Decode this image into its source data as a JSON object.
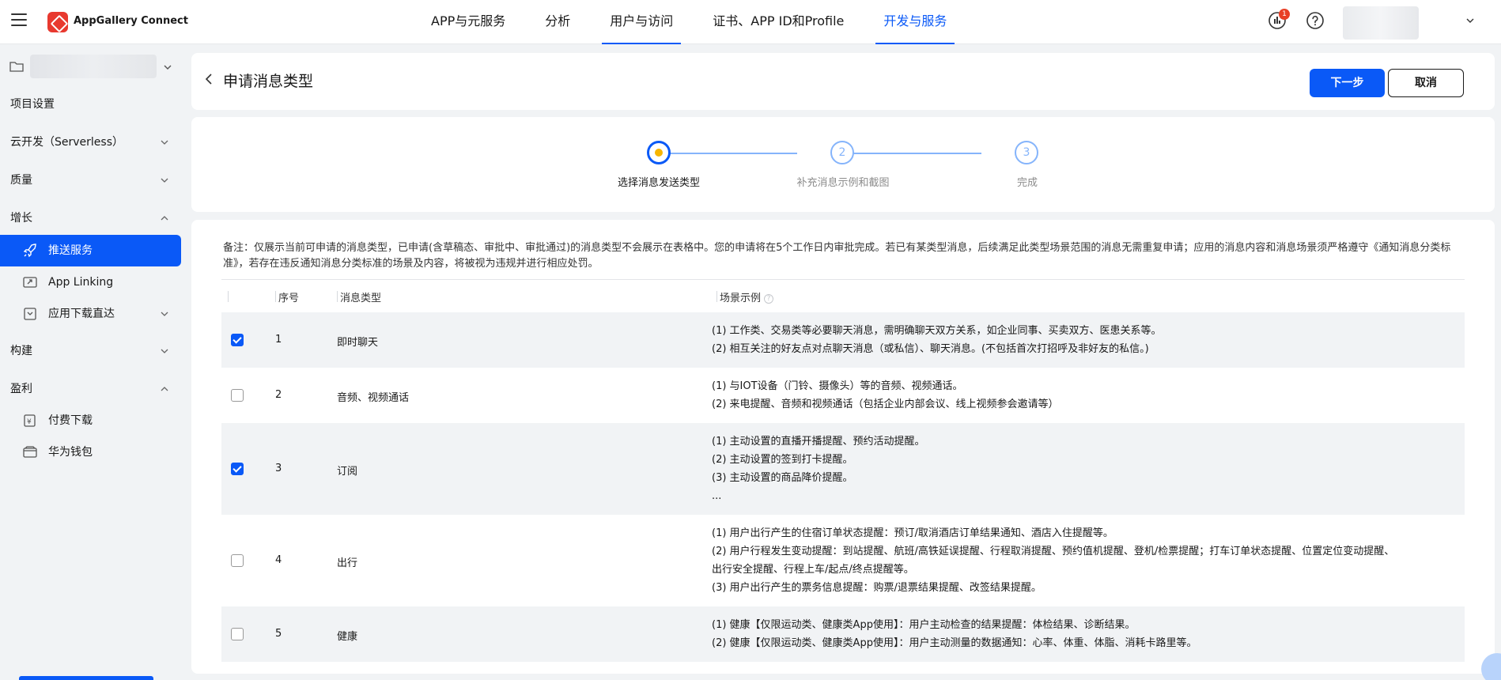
{
  "topbar": {
    "brand": "AppGallery Connect",
    "nav": [
      {
        "label": "APP与元服务",
        "state": "normal"
      },
      {
        "label": "分析",
        "state": "normal"
      },
      {
        "label": "用户与访问",
        "state": "underline"
      },
      {
        "label": "证书、APP ID和Profile",
        "state": "normal"
      },
      {
        "label": "开发与服务",
        "state": "active"
      }
    ],
    "notification_count": "1"
  },
  "sidebar": {
    "items": [
      {
        "label": "项目设置",
        "expandable": false
      },
      {
        "label": "云开发（Serverless）",
        "expandable": true,
        "expanded": false
      },
      {
        "label": "质量",
        "expandable": true,
        "expanded": false
      },
      {
        "label": "增长",
        "expandable": true,
        "expanded": true
      },
      {
        "label": "推送服务",
        "sub": true,
        "active": true,
        "icon": "rocket-icon"
      },
      {
        "label": "App Linking",
        "sub": true,
        "icon": "link-icon"
      },
      {
        "label": "应用下载直达",
        "sub": true,
        "icon": "download-icon",
        "expandable": true
      },
      {
        "label": "构建",
        "expandable": true,
        "expanded": false
      },
      {
        "label": "盈利",
        "expandable": true,
        "expanded": true
      },
      {
        "label": "付费下载",
        "sub": true,
        "icon": "paid-download-icon"
      },
      {
        "label": "华为钱包",
        "sub": true,
        "icon": "wallet-icon"
      }
    ]
  },
  "header": {
    "title": "申请消息类型",
    "next_label": "下一步",
    "cancel_label": "取消"
  },
  "steps": [
    {
      "number": "1",
      "label": "选择消息发送类型",
      "state": "current"
    },
    {
      "number": "2",
      "label": "补充消息示例和截图",
      "state": "pending"
    },
    {
      "number": "3",
      "label": "完成",
      "state": "pending"
    }
  ],
  "note": "备注：仅展示当前可申请的消息类型，已申请(含草稿态、审批中、审批通过)的消息类型不会展示在表格中。您的申请将在5个工作日内审批完成。若已有某类型消息，后续满足此类型场景范围的消息无需重复申请；应用的消息内容和消息场景须严格遵守《通知消息分类标准》，若存在违反通知消息分类标准的场景及内容，将被视为违规并进行相应处罚。",
  "table": {
    "headers": {
      "no": "序号",
      "type": "消息类型",
      "scene": "场景示例"
    },
    "rows": [
      {
        "no": "1",
        "type": "即时聊天",
        "checked": true,
        "scenes": [
          "(1) 工作类、交易类等必要聊天消息，需明确聊天双方关系，如企业同事、买卖双方、医患关系等。",
          "(2) 相互关注的好友点对点聊天消息（或私信）、聊天消息。(不包括首次打招呼及非好友的私信。)"
        ]
      },
      {
        "no": "2",
        "type": "音频、视频通话",
        "checked": false,
        "scenes": [
          "(1) 与IOT设备（门铃、摄像头）等的音频、视频通话。",
          "(2) 来电提醒、音频和视频通话（包括企业内部会议、线上视频参会邀请等）"
        ]
      },
      {
        "no": "3",
        "type": "订阅",
        "checked": true,
        "scenes": [
          "(1) 主动设置的直播开播提醒、预约活动提醒。",
          "(2) 主动设置的签到打卡提醒。",
          "(3) 主动设置的商品降价提醒。",
          "..."
        ]
      },
      {
        "no": "4",
        "type": "出行",
        "checked": false,
        "scenes": [
          "(1) 用户出行产生的住宿订单状态提醒：预订/取消酒店订单结果通知、酒店入住提醒等。",
          "(2) 用户行程发生变动提醒：到站提醒、航班/高铁延误提醒、行程取消提醒、预约值机提醒、登机/检票提醒；打车订单状态提醒、位置定位变动提醒、",
          "出行安全提醒、行程上车/起点/终点提醒等。",
          "(3) 用户出行产生的票务信息提醒：购票/退票结果提醒、改签结果提醒。"
        ]
      },
      {
        "no": "5",
        "type": "健康",
        "checked": false,
        "scenes": [
          "(1) 健康【仅限运动类、健康类App使用】：用户主动检查的结果提醒：体检结果、诊断结果。",
          "(2) 健康【仅限运动类、健康类App使用】：用户主动测量的数据通知：心率、体重、体脂、消耗卡路里等。"
        ]
      }
    ]
  },
  "colors": {
    "accent": "#0a59f7",
    "step_dot": "#f7b500",
    "badge": "#e84026"
  }
}
